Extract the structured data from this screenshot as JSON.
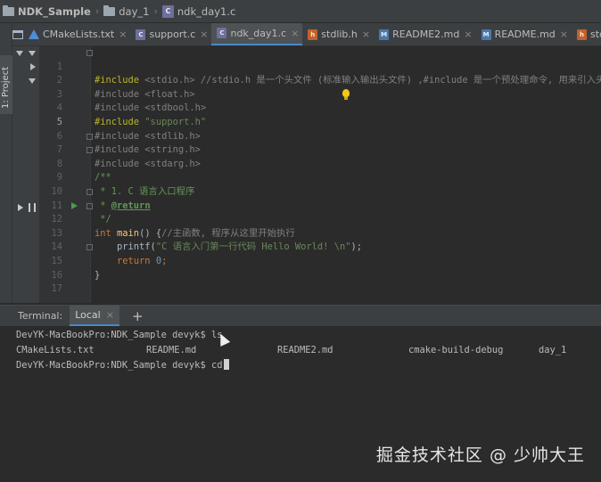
{
  "breadcrumb": {
    "project": "NDK_Sample",
    "folder": "day_1",
    "file": "ndk_day1.c",
    "file_icon": "c-file-icon",
    "folder_icon": "folder-icon"
  },
  "left_strip": {
    "project_label": "1: Project"
  },
  "tabs": [
    {
      "label": "CMakeLists.txt",
      "icon": "cmake-icon",
      "active": false
    },
    {
      "label": "support.c",
      "icon": "c-file-icon",
      "active": false
    },
    {
      "label": "ndk_day1.c",
      "icon": "c-file-icon",
      "active": true
    },
    {
      "label": "stdlib.h",
      "icon": "h-file-icon",
      "active": false
    },
    {
      "label": "README2.md",
      "icon": "md-file-icon",
      "active": false
    },
    {
      "label": "README.md",
      "icon": "md-file-icon",
      "active": false
    },
    {
      "label": "stdio.h",
      "icon": "h-file-icon",
      "active": false
    }
  ],
  "tab_close_glyph": "×",
  "editor": {
    "line_numbers": [
      "1",
      "2",
      "3",
      "4",
      "5",
      "6",
      "7",
      "8",
      "9",
      "10",
      "11",
      "12",
      "13",
      "14",
      "15",
      "16",
      "17"
    ],
    "current_line": "5",
    "lines": {
      "l1_directive": "#include",
      "l1_header": " <stdio.h>",
      "l1_comment": " //stdio.h 是一个头文件 (标准输入输出头文件) ,#include 是一个预处理命令, 用来引入头文",
      "l2": "#include <float.h>",
      "l3": "#include <stdbool.h>",
      "l4_directive": "#include",
      "l4_header": " \"support.h\"",
      "l5": "#include <stdlib.h>",
      "l6": "#include <string.h>",
      "l7": "#include <stdarg.h>",
      "l8": "/**",
      "l9": " * 1. C 语言入口程序",
      "l10_star": " * ",
      "l10_tag": "@return",
      "l11": " */",
      "l12_kw": "int",
      "l12_fn": " main",
      "l12_rest": "() {",
      "l12_comment": "//主函数, 程序从这里开始执行",
      "l13_call": "    printf(",
      "l13_str": "\"C 语言入门第一行代码 Hello World! \\n\"",
      "l13_end": ");",
      "l14_kw": "    return",
      "l14_num": " 0",
      "l14_end": ";",
      "l15": "}"
    }
  },
  "terminal": {
    "label": "Terminal:",
    "tab": "Local",
    "add": "+",
    "prompt1": "DevYK-MacBookPro:NDK_Sample devyk$ ls",
    "files": [
      "CMakeLists.txt",
      "README.md",
      "README2.md",
      "cmake-build-debug",
      "day_1"
    ],
    "prompt2": "DevYK-MacBookPro:NDK_Sample devyk$ cd"
  },
  "watermark": "掘金技术社区 @ 少帅大王",
  "colors": {
    "accent": "#4a88c7",
    "keyword": "#cc7832",
    "preprocessor": "#bbb529",
    "string": "#6a8759",
    "doc_comment": "#629755",
    "number": "#6897bb",
    "function": "#ffc66d",
    "run_green": "#499c54",
    "bulb": "#f5c518"
  }
}
